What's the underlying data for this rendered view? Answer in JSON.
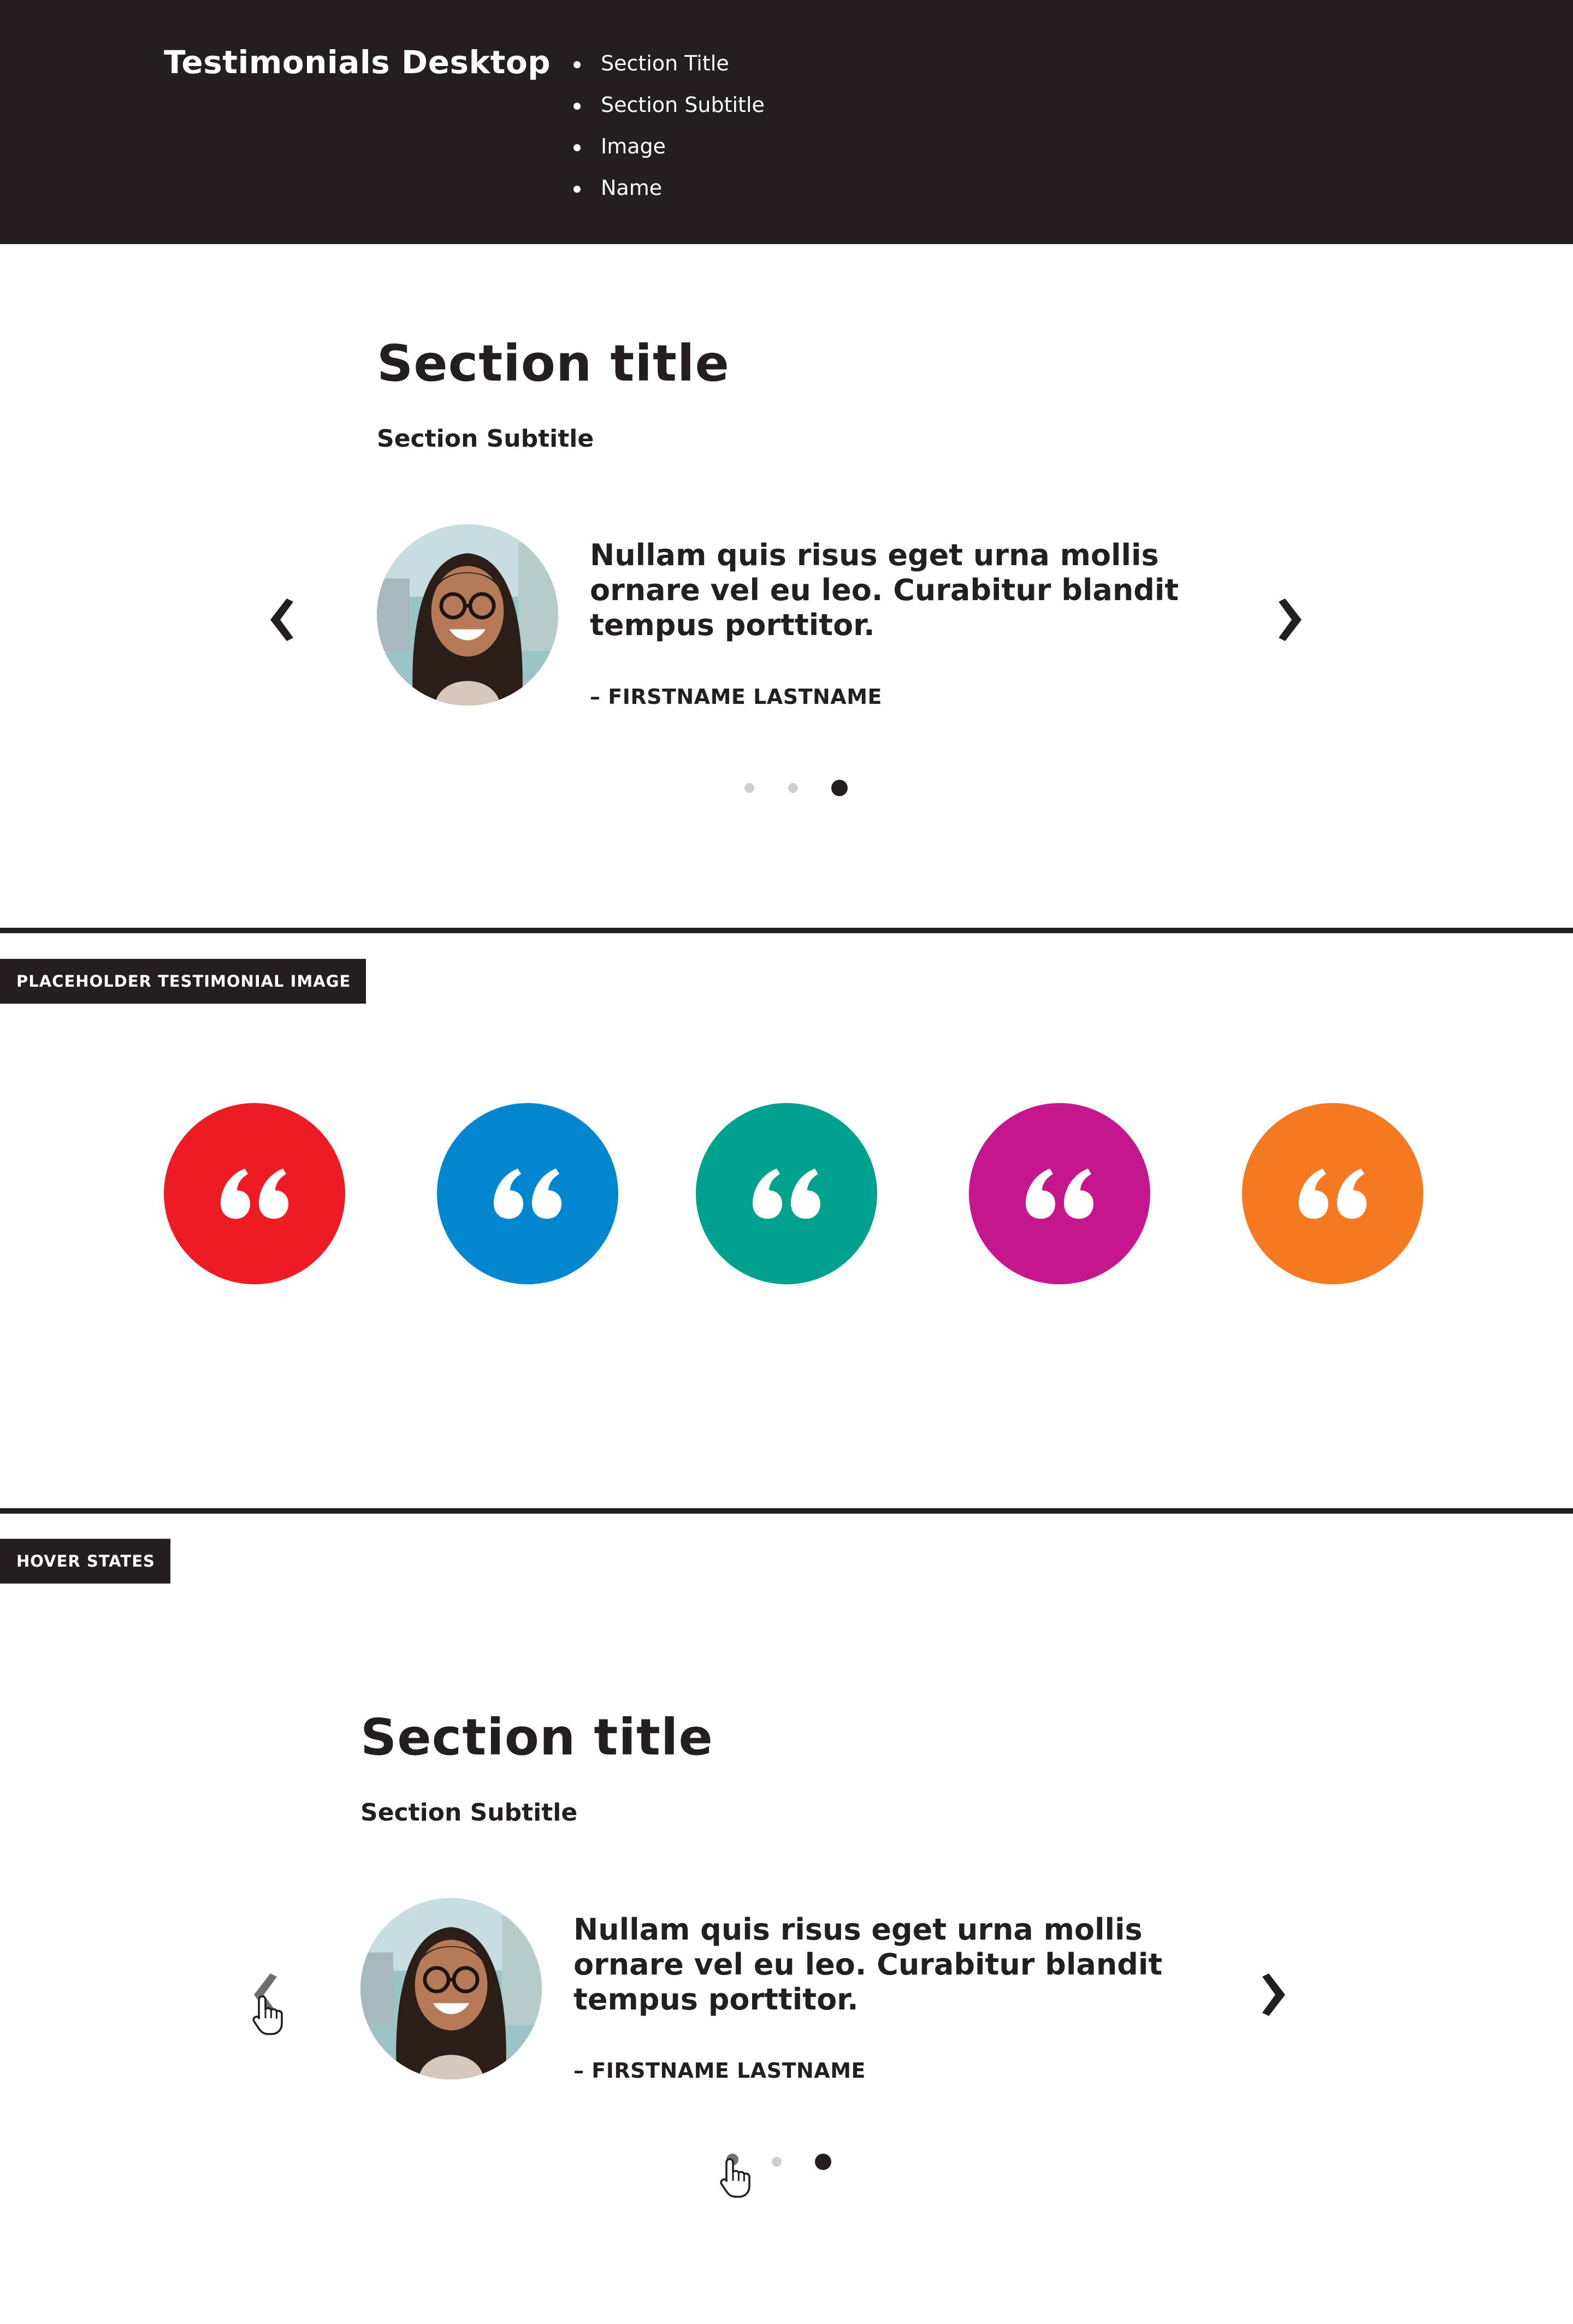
{
  "header": {
    "title": "Testimonials Desktop",
    "items": [
      "Section Title",
      "Section Subtitle",
      "Image",
      "Name"
    ]
  },
  "testimonial": {
    "title": "Section title",
    "subtitle": "Section Subtitle",
    "quote": "Nullam quis risus eget urna mollis ornare vel eu leo. Curabitur blandit tempus porttitor.",
    "author": "– FIRSTNAME LASTNAME",
    "prev_icon": "chevron-left-icon",
    "next_icon": "chevron-right-icon",
    "active_slide": 3,
    "slide_count": 3
  },
  "placeholder": {
    "label": "PLACEHOLDER TESTIMONIAL IMAGE",
    "icon": "quote-icon",
    "colors": [
      "#ed1c24",
      "#0087d0",
      "#00a28e",
      "#c6168d",
      "#f47920"
    ]
  },
  "hover": {
    "label": "HOVER STATES",
    "title": "Section title",
    "subtitle": "Section Subtitle",
    "quote": "Nullam quis risus eget urna mollis ornare vel eu leo. Curabitur blandit tempus porttitor.",
    "author": "– FIRSTNAME LASTNAME",
    "cursor_icon": "hand-pointer-icon"
  },
  "colors": {
    "dark": "#231f20",
    "dot_inactive": "#cfcfcf",
    "hover_arrow": "#6d6e71"
  }
}
